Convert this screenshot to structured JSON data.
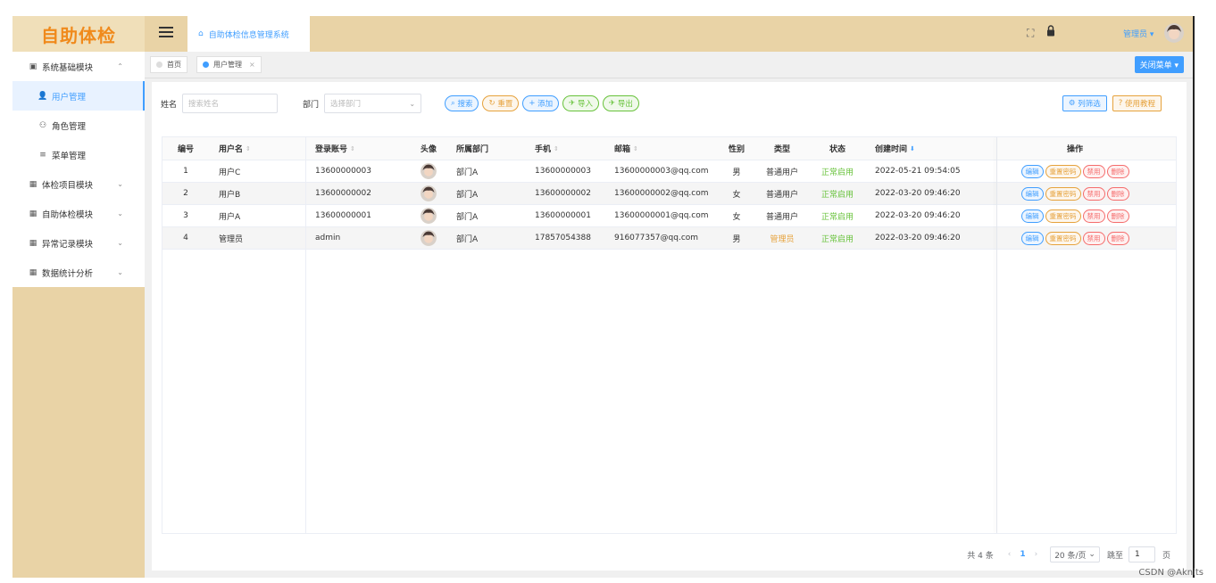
{
  "logo": "自助体检",
  "sidebar": {
    "items": [
      {
        "label": "系统基础模块",
        "icon": "dashboard-icon",
        "chevron": "^"
      },
      {
        "label": "用户管理",
        "icon": "user-icon",
        "active": true
      },
      {
        "label": "角色管理",
        "icon": "role-icon"
      },
      {
        "label": "菜单管理",
        "icon": "menu-list-icon"
      },
      {
        "label": "体检项目模块",
        "icon": "grid-icon",
        "chevron": "v"
      },
      {
        "label": "自助体检模块",
        "icon": "grid-icon",
        "chevron": "v"
      },
      {
        "label": "异常记录模块",
        "icon": "grid-icon",
        "chevron": "v"
      },
      {
        "label": "数据统计分析",
        "icon": "grid-icon",
        "chevron": "v"
      }
    ]
  },
  "header": {
    "home_tab": "自助体检信息管理系统",
    "user": "管理员 ▾"
  },
  "tags": [
    {
      "label": "首页"
    },
    {
      "label": "用户管理",
      "close": "×"
    }
  ],
  "close_menu": "关闭菜单 ▾",
  "filter": {
    "name_label": "姓名",
    "name_placeholder": "搜索姓名",
    "dept_label": "部门",
    "dept_placeholder": "选择部门"
  },
  "buttons": {
    "search": "搜索",
    "reset": "重置",
    "add": "添加",
    "import": "导入",
    "export": "导出",
    "column_filter": "列筛选",
    "tutorial": "使用教程"
  },
  "table": {
    "columns": [
      "编号",
      "用户名",
      "登录账号",
      "头像",
      "所属部门",
      "手机",
      "邮箱",
      "性别",
      "类型",
      "状态",
      "创建时间",
      "操作"
    ],
    "rows": [
      {
        "id": "1",
        "username": "用户C",
        "account": "13600000003",
        "dept": "部门A",
        "phone": "13600000003",
        "email": "13600000003@qq.com",
        "gender": "男",
        "type": "普通用户",
        "status": "正常启用",
        "created": "2022-05-21 09:54:05"
      },
      {
        "id": "2",
        "username": "用户B",
        "account": "13600000002",
        "dept": "部门A",
        "phone": "13600000002",
        "email": "13600000002@qq.com",
        "gender": "女",
        "type": "普通用户",
        "status": "正常启用",
        "created": "2022-03-20 09:46:20"
      },
      {
        "id": "3",
        "username": "用户A",
        "account": "13600000001",
        "dept": "部门A",
        "phone": "13600000001",
        "email": "13600000001@qq.com",
        "gender": "女",
        "type": "普通用户",
        "status": "正常启用",
        "created": "2022-03-20 09:46:20"
      },
      {
        "id": "4",
        "username": "管理员",
        "account": "admin",
        "dept": "部门A",
        "phone": "17857054388",
        "email": "916077357@qq.com",
        "gender": "男",
        "type": "管理员",
        "status": "正常启用",
        "created": "2022-03-20 09:46:20"
      }
    ],
    "ops": [
      "编辑",
      "重置密码",
      "禁用",
      "删除"
    ]
  },
  "pager": {
    "total": "共 4 条",
    "page": "1",
    "size": "20 条/页",
    "jump_label": "跳至",
    "jump_value": "1",
    "page_unit": "页"
  },
  "watermark": "CSDN @Aknits",
  "colors": {
    "accent": "#409eff",
    "sidebar_bg": "#e9d3a6",
    "logo": "#f08a1c"
  }
}
